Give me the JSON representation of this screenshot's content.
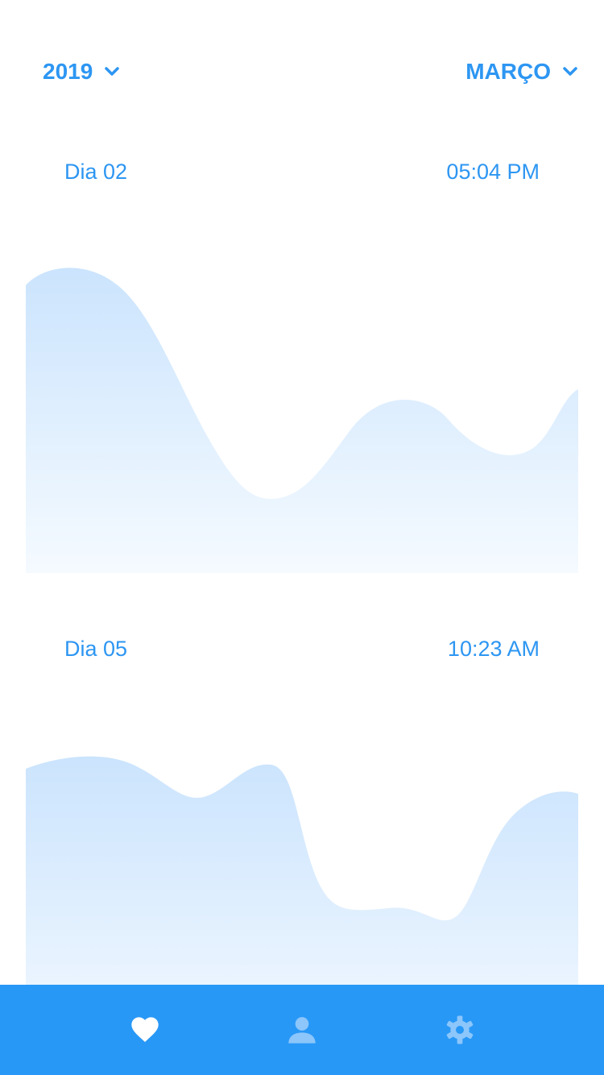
{
  "header": {
    "year_label": "2019",
    "month_label": "MARÇO"
  },
  "entries": [
    {
      "day_label": "Dia 02",
      "time_label": "05:04 PM"
    },
    {
      "day_label": "Dia 05",
      "time_label": "10:23 AM"
    }
  ],
  "colors": {
    "accent": "#2d96f2",
    "tabbar": "#2898f7",
    "wave_top": "#cbe4fd",
    "wave_bottom": "#f5faff",
    "tab_active": "#ffffff",
    "tab_inactive": "#8cc6fa"
  },
  "tabs": [
    {
      "icon": "heart-icon",
      "active": true
    },
    {
      "icon": "user-icon",
      "active": false
    },
    {
      "icon": "gear-icon",
      "active": false
    }
  ]
}
